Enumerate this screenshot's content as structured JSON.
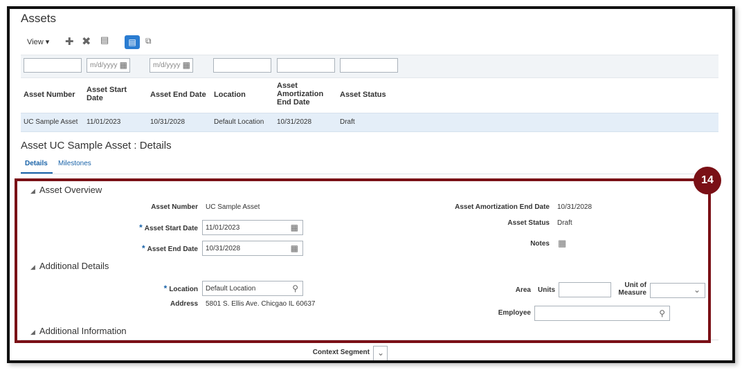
{
  "page": {
    "title": "Assets"
  },
  "toolbar": {
    "view_label": "View ▾",
    "icons": [
      "add-icon",
      "delete-icon",
      "freeze-icon",
      "query-by-example-icon",
      "detach-icon"
    ]
  },
  "filters": {
    "start_date_placeholder": "m/d/yyyy",
    "end_date_placeholder": "m/d/yyyy"
  },
  "table": {
    "columns": [
      "Asset Number",
      "Asset Start Date",
      "Asset End Date",
      "Location",
      "Asset Amortization End Date",
      "Asset Status"
    ],
    "columns_display": [
      "Asset Number",
      "Asset Start\nDate",
      "Asset End Date",
      "Location",
      "Asset\nAmortization\nEnd Date",
      "Asset Status"
    ],
    "rows": [
      {
        "asset_number": "UC Sample Asset",
        "start_date": "11/01/2023",
        "end_date": "10/31/2028",
        "location": "Default Location",
        "amortization_end_date": "10/31/2028",
        "status": "Draft"
      }
    ]
  },
  "details": {
    "title": "Asset UC Sample Asset : Details",
    "tabs": [
      "Details",
      "Milestones"
    ],
    "asset_overview": {
      "heading": "Asset Overview",
      "asset_number_label": "Asset Number",
      "asset_number": "UC Sample Asset",
      "start_date_label": "Asset Start Date",
      "start_date": "11/01/2023",
      "end_date_label": "Asset End Date",
      "end_date": "10/31/2028",
      "amortization_end_date_label": "Asset Amortization End Date",
      "amortization_end_date": "10/31/2028",
      "status_label": "Asset Status",
      "status": "Draft",
      "notes_label": "Notes"
    },
    "additional_details": {
      "heading": "Additional Details",
      "location_label": "Location",
      "location": "Default Location",
      "address_label": "Address",
      "address": "5801 S. Ellis Ave. Chicgao IL 60637",
      "area_label": "Area",
      "units_label": "Units",
      "unit_of_measure_label_1": "Unit of",
      "unit_of_measure_label_2": "Measure",
      "employee_label": "Employee"
    },
    "additional_information": {
      "heading": "Additional Information",
      "context_segment_label": "Context Segment"
    }
  },
  "callout": {
    "number": "14",
    "color": "#7a1016"
  },
  "colors": {
    "accent": "#2a7cd1",
    "selected_row": "#e4eef8",
    "link": "#1a63a8"
  }
}
